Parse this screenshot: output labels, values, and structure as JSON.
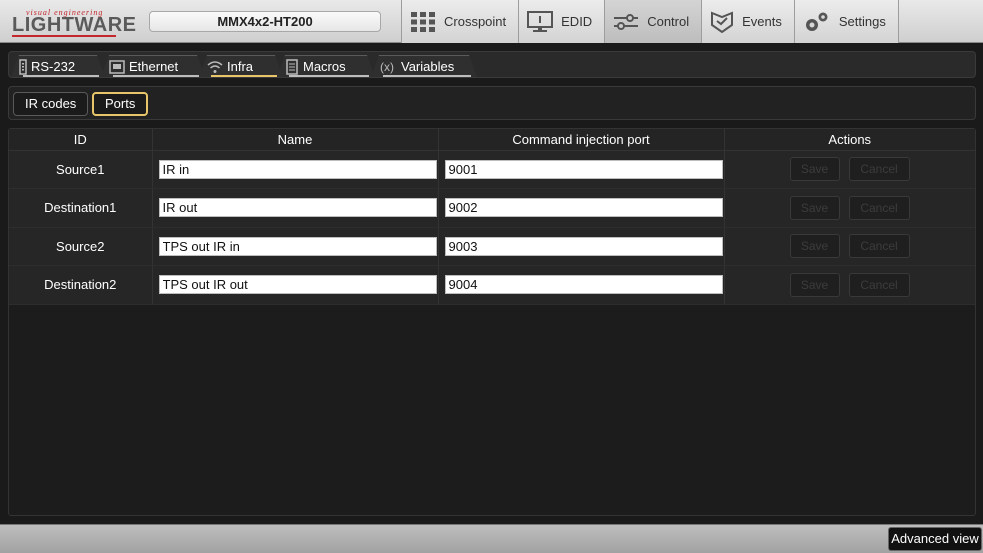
{
  "brand": {
    "tagline": "visual engineering",
    "name": "LIGHTWARE"
  },
  "device": {
    "name": "MMX4x2-HT200"
  },
  "nav": {
    "items": [
      {
        "label": "Crosspoint",
        "icon": "grid-icon"
      },
      {
        "label": "EDID",
        "icon": "monitor-icon"
      },
      {
        "label": "Control",
        "icon": "sliders-icon",
        "active": true
      },
      {
        "label": "Events",
        "icon": "events-icon"
      },
      {
        "label": "Settings",
        "icon": "gear-icon"
      }
    ]
  },
  "tabs": [
    {
      "label": "RS-232",
      "icon": "serial-icon"
    },
    {
      "label": "Ethernet",
      "icon": "ethernet-icon"
    },
    {
      "label": "Infra",
      "icon": "infrared-icon",
      "active": true
    },
    {
      "label": "Macros",
      "icon": "document-icon"
    },
    {
      "label": "Variables",
      "icon": "variable-icon"
    }
  ],
  "subtabs": [
    {
      "label": "IR codes"
    },
    {
      "label": "Ports",
      "selected": true
    }
  ],
  "table": {
    "headers": {
      "id": "ID",
      "name": "Name",
      "port": "Command injection port",
      "actions": "Actions"
    },
    "rows": [
      {
        "id": "Source1",
        "name": "IR in",
        "port": "9001"
      },
      {
        "id": "Destination1",
        "name": "IR out",
        "port": "9002"
      },
      {
        "id": "Source2",
        "name": "TPS out IR in",
        "port": "9003"
      },
      {
        "id": "Destination2",
        "name": "TPS out IR out",
        "port": "9004"
      }
    ],
    "save_label": "Save",
    "cancel_label": "Cancel"
  },
  "footer": {
    "advanced_view_label": "Advanced view"
  },
  "colors": {
    "accent": "#e8c56a",
    "brand_red": "#c4262e"
  }
}
